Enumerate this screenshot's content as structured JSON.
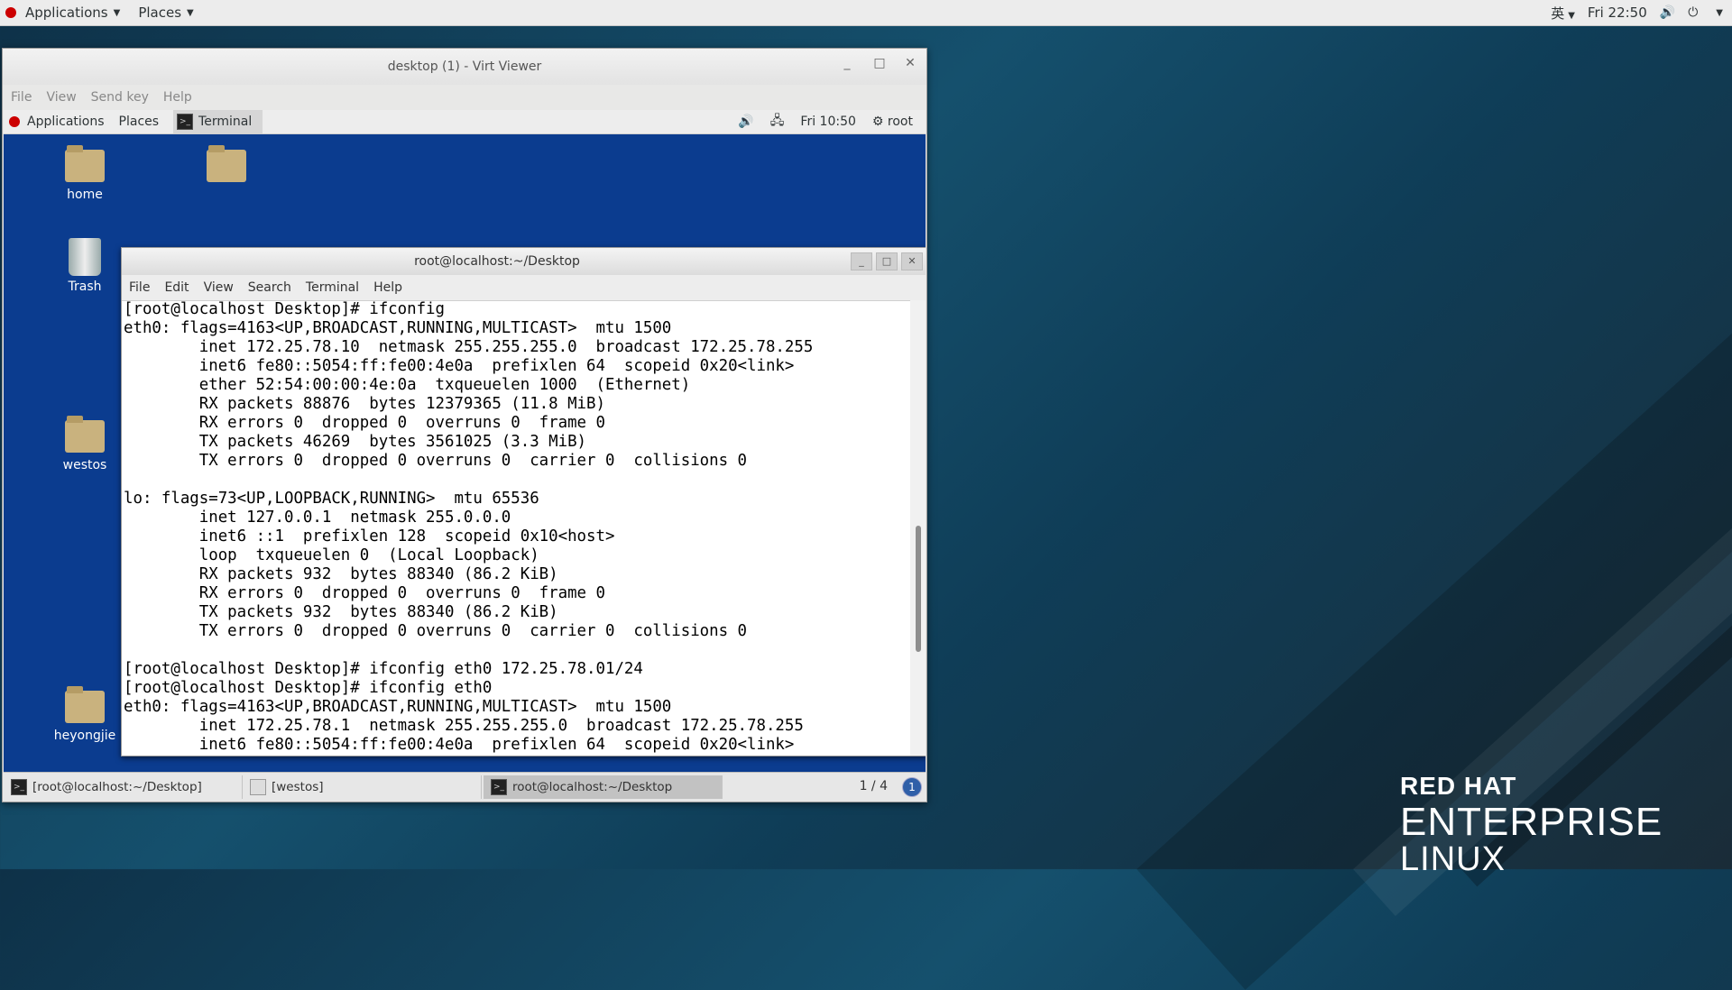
{
  "host_panel": {
    "applications": "Applications",
    "places": "Places",
    "ime": "英",
    "clock": "Fri 22:50"
  },
  "virt_viewer": {
    "title": "desktop (1) - Virt Viewer",
    "menu": [
      "File",
      "View",
      "Send key",
      "Help"
    ]
  },
  "guest_panel": {
    "applications": "Applications",
    "places": "Places",
    "task": "Terminal",
    "clock": "Fri 10:50",
    "user": "root"
  },
  "desktop_icons": {
    "home": "home",
    "trash": "Trash",
    "westos": "westos",
    "heyongjie": "heyongjie"
  },
  "terminal": {
    "title": "root@localhost:~/Desktop",
    "menu": [
      "File",
      "Edit",
      "View",
      "Search",
      "Terminal",
      "Help"
    ],
    "lines": [
      "[root@localhost Desktop]# ifconfig",
      "eth0: flags=4163<UP,BROADCAST,RUNNING,MULTICAST>  mtu 1500",
      "        inet 172.25.78.10  netmask 255.255.255.0  broadcast 172.25.78.255",
      "        inet6 fe80::5054:ff:fe00:4e0a  prefixlen 64  scopeid 0x20<link>",
      "        ether 52:54:00:00:4e:0a  txqueuelen 1000  (Ethernet)",
      "        RX packets 88876  bytes 12379365 (11.8 MiB)",
      "        RX errors 0  dropped 0  overruns 0  frame 0",
      "        TX packets 46269  bytes 3561025 (3.3 MiB)",
      "        TX errors 0  dropped 0 overruns 0  carrier 0  collisions 0",
      "",
      "lo: flags=73<UP,LOOPBACK,RUNNING>  mtu 65536",
      "        inet 127.0.0.1  netmask 255.0.0.0",
      "        inet6 ::1  prefixlen 128  scopeid 0x10<host>",
      "        loop  txqueuelen 0  (Local Loopback)",
      "        RX packets 932  bytes 88340 (86.2 KiB)",
      "        RX errors 0  dropped 0  overruns 0  frame 0",
      "        TX packets 932  bytes 88340 (86.2 KiB)",
      "        TX errors 0  dropped 0 overruns 0  carrier 0  collisions 0",
      "",
      "[root@localhost Desktop]# ifconfig eth0 172.25.78.01/24",
      "[root@localhost Desktop]# ifconfig eth0",
      "eth0: flags=4163<UP,BROADCAST,RUNNING,MULTICAST>  mtu 1500",
      "        inet 172.25.78.1  netmask 255.255.255.0  broadcast 172.25.78.255",
      "        inet6 fe80::5054:ff:fe00:4e0a  prefixlen 64  scopeid 0x20<link>"
    ]
  },
  "guest_taskbar": {
    "items": [
      "[root@localhost:~/Desktop]",
      "[westos]",
      "root@localhost:~/Desktop"
    ],
    "pager": "1 / 4",
    "badge": "1"
  },
  "branding": {
    "line1": "RED HAT",
    "line2": "ENTERPRISE",
    "line3": "LINUX"
  }
}
